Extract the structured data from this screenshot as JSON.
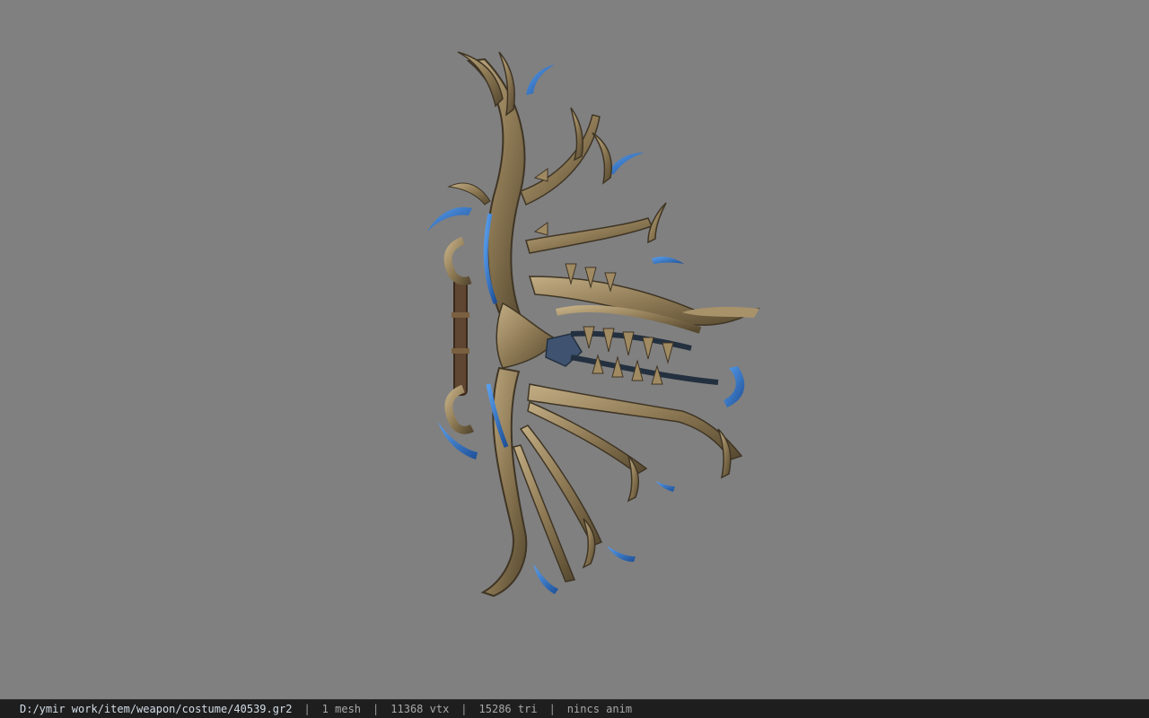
{
  "viewport": {
    "background": "#808080",
    "model_colors": {
      "bronze": "#8e7a55",
      "bronze_light": "#b9a37a",
      "bronze_dark": "#4f4330",
      "blue_accent": "#2f6fc4",
      "dark_recess": "#23303f"
    }
  },
  "statusbar": {
    "path": "D:/ymir work/item/weapon/costume/40539.gr2",
    "separator": "|",
    "mesh": "1 mesh",
    "vtx": "11368 vtx",
    "tri": "15286 tri",
    "anim": "nincs anim"
  }
}
